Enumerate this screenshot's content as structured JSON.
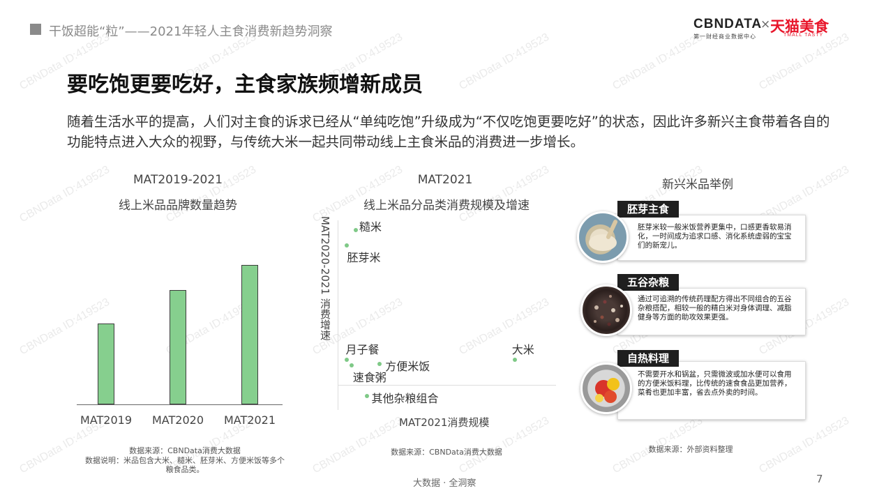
{
  "header": {
    "title": "干饭超能“粒”——2021年轻人主食消费新趋势洞察",
    "logo_cbndata": "CBNDATA",
    "logo_cbndata_sub": "第一财经商业数据中心",
    "logo_x": "×",
    "logo_tmall": "天猫美食",
    "logo_tmall_sub": "TMALL TASTY"
  },
  "main_title": "要吃饱更要吃好，主食家族频增新成员",
  "subtitle": "随着生活水平的提高，人们对主食的诉求已经从“单纯吃饱”升级成为“不仅吃饱更要吃好”的状态，因此许多新兴主食带着各自的功能特点进入大众的视野，与传统大米一起共同带动线上主食米品的消费进一步增长。",
  "bar_section": {
    "period": "MAT2019-2021",
    "caption": "线上米品品牌数量趋势",
    "source": "数据来源：CBNData消费大数据",
    "note_line1": "数据说明：米品包含大米、糙米、胚芽米、方便米饭等多个",
    "note_line2": "粮食品类。"
  },
  "scatter_section": {
    "period": "MAT2021",
    "caption": "线上米品分品类消费规模及增速",
    "source": "数据来源：CBNData消费大数据"
  },
  "chart_data": [
    {
      "type": "bar",
      "title": "线上米品品牌数量趋势",
      "categories": [
        "MAT2019",
        "MAT2020",
        "MAT2021"
      ],
      "values": [
        0.58,
        0.82,
        1.0
      ],
      "color": "#86cf8e"
    },
    {
      "type": "scatter",
      "title": "线上米品分品类消费规模及增速",
      "xlabel": "MAT2021消费规模",
      "ylabel": "MAT2020-2021 消费增速",
      "points": [
        {
          "label": "糙米",
          "x": 0.08,
          "y": 0.95
        },
        {
          "label": "胚芽米",
          "x": 0.04,
          "y": 0.87
        },
        {
          "label": "大米",
          "x": 0.81,
          "y": 0.27
        },
        {
          "label": "月子餐",
          "x": 0.04,
          "y": 0.27
        },
        {
          "label": "方便米饭",
          "x": 0.19,
          "y": 0.25
        },
        {
          "label": "速食粥",
          "x": 0.06,
          "y": 0.24
        },
        {
          "label": "其他杂粮组合",
          "x": 0.13,
          "y": 0.08
        }
      ],
      "color": "#7fc987"
    }
  ],
  "examples": {
    "title": "新兴米品举例",
    "source": "数据来源：外部资料整理",
    "cards": [
      {
        "name": "胚芽主食",
        "desc": "胚芽米较一般米饭营养更集中，口感更香软易消化，一时间成为追求口感、消化系统虚弱的宝宝们的新宠儿。",
        "icon": "germ-rice-bowl-icon"
      },
      {
        "name": "五谷杂粮",
        "desc": "通过可追溯的传统药理配方得出不同组合的五谷杂粮搭配，相较一般的精白米对身体调理、减脂健身等方面的助攻效果更强。",
        "icon": "mixed-grains-icon"
      },
      {
        "name": "自热料理",
        "desc": "不需要开水和锅盆，只需微波或加水便可以食用的方便米饭料理，比传统的速食食品更加营养，菜肴也更加丰富，省去点外卖的时间。",
        "icon": "self-heating-rice-icon"
      }
    ]
  },
  "footer": {
    "tagline": "大数据 · 全洞察",
    "page_number": "7"
  },
  "watermark": "CBNData ID:419523",
  "colors": {
    "bar": "#86cf8e",
    "dot": "#7fc987",
    "tag_bg": "#1f1f1f",
    "tmall_red": "#e8152a"
  }
}
